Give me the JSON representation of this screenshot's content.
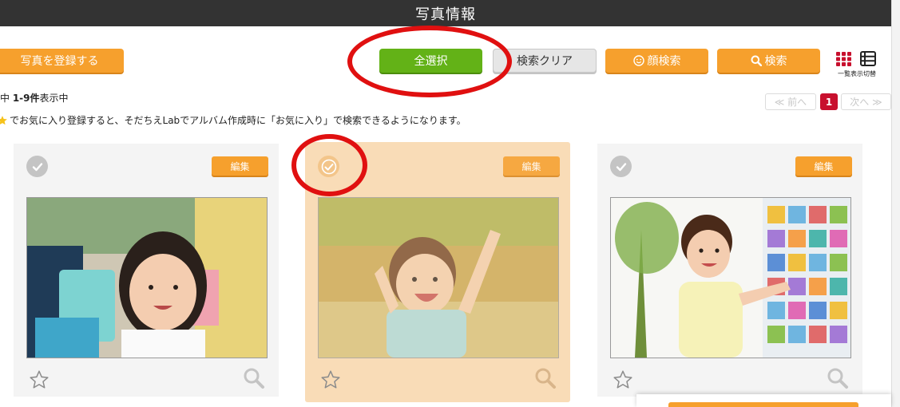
{
  "header": {
    "title": "写真情報"
  },
  "toolbar": {
    "register_label": "写真を登録する",
    "select_all_label": "全選択",
    "clear_label": "検索クリア",
    "face_search_label": "顔検索",
    "search_label": "検索",
    "view_toggle_caption": "一覧表示切替"
  },
  "results": {
    "prefix": "中 ",
    "range": "1-9件",
    "suffix": "表示中"
  },
  "pagination": {
    "prev_label": "≪ 前へ",
    "current_page": "1",
    "next_label": "次へ ≫"
  },
  "favorites_note": "でお気に入り登録すると、そだちえLabでアルバム作成時に「お気に入り」で検索できるようになります。",
  "cards": [
    {
      "edit_label": "編集",
      "selected": false
    },
    {
      "edit_label": "編集",
      "selected": true
    },
    {
      "edit_label": "編集",
      "selected": false
    }
  ],
  "colors": {
    "header_bg": "#333333",
    "accent_orange": "#f6a02d",
    "select_green": "#63b217",
    "selected_card_bg": "#f9dcb7",
    "page_current": "#c8102e",
    "annotation_red": "#e01010"
  }
}
